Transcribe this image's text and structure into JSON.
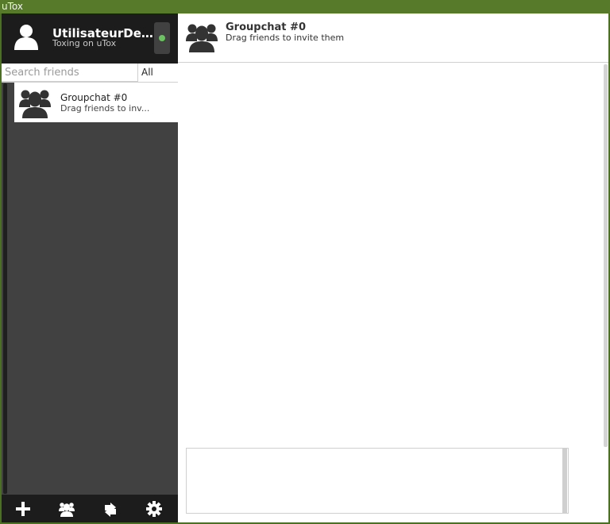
{
  "window": {
    "title": "uTox"
  },
  "self": {
    "name": "UtilisateurDeT...",
    "status_message": "Toxing on uTox",
    "status_color": "#6bc260"
  },
  "search": {
    "placeholder": "Search friends",
    "filter_label": "All"
  },
  "friends": [
    {
      "name": "Groupchat #0",
      "status": "Drag friends to inv...",
      "icon": "group-icon"
    }
  ],
  "chat": {
    "title": "Groupchat #0",
    "subtitle": "Drag friends to invite them",
    "compose_value": ""
  },
  "bottom_bar": {
    "buttons": [
      {
        "icon": "add-icon"
      },
      {
        "icon": "group-icon"
      },
      {
        "icon": "transfer-icon"
      },
      {
        "icon": "settings-icon"
      }
    ]
  },
  "colors": {
    "window_frame": "#4b7023",
    "sidebar_dark": "#1c1c1c",
    "sidebar": "#414141",
    "online": "#6bc260"
  }
}
